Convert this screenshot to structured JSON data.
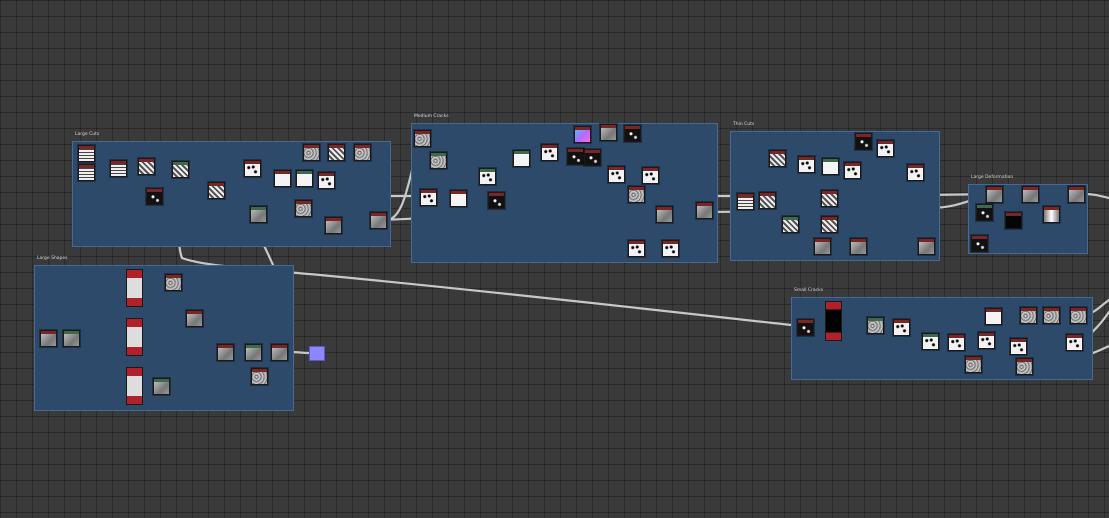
{
  "frames": {
    "large_cuts": "Large Cuts",
    "large_shapes": "Large Shapes",
    "medium_cracks": "Medium Cracks",
    "thin_cuts": "Thin Cuts",
    "large_deformation": "Large Deformation",
    "small_cracks": "Small Cracks"
  },
  "colors": {
    "background": "#3a3a3a",
    "frame_fill": "#2e4a6b",
    "node_header": "#7a2626",
    "wire": "#c8c8c8",
    "output_node": "#8d87ff"
  }
}
